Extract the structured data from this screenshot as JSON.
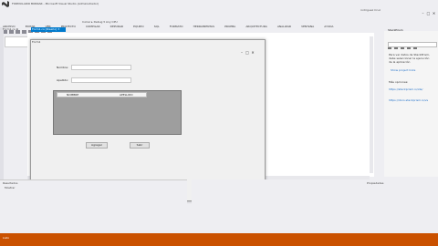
{
  "window": {
    "title": "FORMULARIO BORRAR - Microsoft Visual Studio (Administrador)",
    "user": "rodriguez Cruz",
    "controls": [
      "–",
      "□",
      "✕"
    ]
  },
  "menu": [
    "ARCHIVO",
    "EDITAR",
    "VER",
    "PROYECTO",
    "COMPILAR",
    "DEPURAR",
    "EQUIPO",
    "SQL",
    "FORMATO",
    "HERRAMIENTAS",
    "PRUEBA",
    "ARQUITECTURA",
    "ANALIZAR",
    "VENTANA",
    "AYUDA"
  ],
  "toolbar": {
    "text": "Iniciar ▸  Debug  ▾  Any CPU"
  },
  "tabs": {
    "left": "Form1.cs ⊕",
    "active": "Form1.cs [Diseño] ✕"
  },
  "form": {
    "title": "Form1",
    "controls": [
      "–",
      "□",
      "✕"
    ],
    "label_nombre": "Nombre:",
    "label_apellido": "Apellido:",
    "col_nombre": "NOMBRE",
    "col_apellido": "APELLIDO",
    "btn_agregar": "Agregar",
    "btn_salir": "Salir"
  },
  "right_panel": {
    "title": "StackPrism",
    "text1": "Para ver datos de StackPrism,",
    "text2": "debe seleccionar la ejecución",
    "text3": "de la aplicación",
    "link1": "Show project links",
    "header2": "Más opciones:",
    "link2": "https://stackprism.io/ide/",
    "link3": "https://docs.stackprism.io/vs"
  },
  "bottom": {
    "output_title": "Resultados",
    "output_sub": "Mostrar",
    "tabs_left": [
      "Lista de errores",
      "Ventana Inm.",
      "Explorador de"
    ],
    "tabs_mid": [
      "Ventana de ver",
      "Explorador de soluciones",
      "Vista de clases"
    ],
    "tabs_far": [
      "Propiedades",
      "Team"
    ],
    "props_title": "Propiedades"
  },
  "status": {
    "text": "Listo"
  }
}
